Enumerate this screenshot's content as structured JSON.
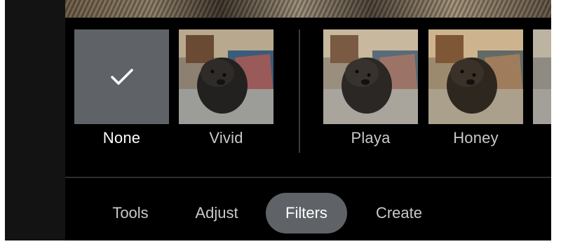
{
  "filters": [
    {
      "label": "None",
      "selected": true,
      "icon": "check-icon"
    },
    {
      "label": "Vivid",
      "selected": false
    },
    {
      "label": "Playa",
      "selected": false
    },
    {
      "label": "Honey",
      "selected": false
    }
  ],
  "tabs": [
    {
      "label": "Tools",
      "active": false
    },
    {
      "label": "Adjust",
      "active": false
    },
    {
      "label": "Filters",
      "active": true
    },
    {
      "label": "Create",
      "active": false
    }
  ],
  "colors": {
    "background": "#000000",
    "selected_tile": "#5f6368",
    "active_tab": "#5f6368",
    "inactive_text": "#c9c9c9",
    "active_text": "#ffffff"
  }
}
